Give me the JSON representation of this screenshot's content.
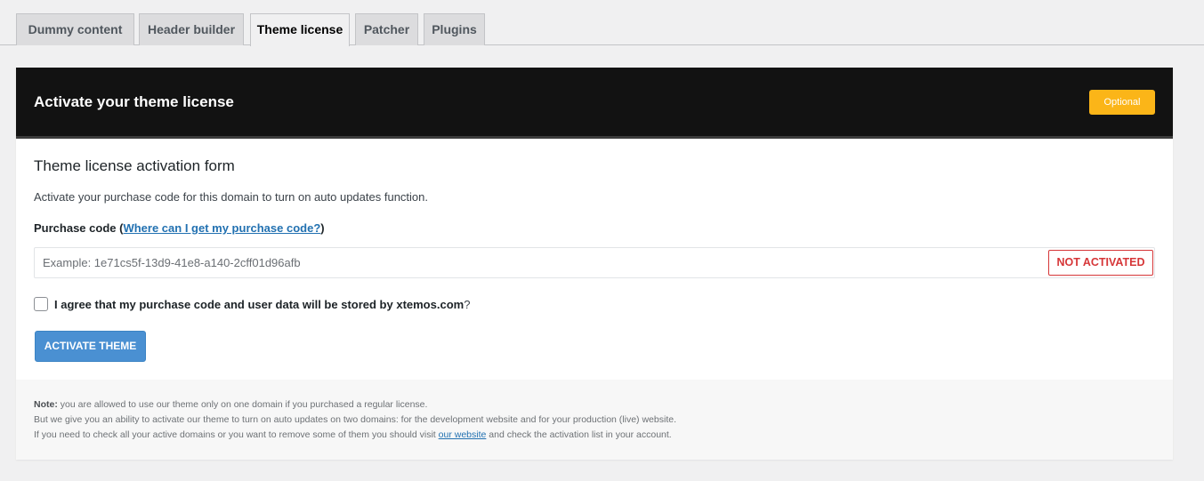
{
  "tabs": [
    {
      "label": "Dummy content",
      "active": false
    },
    {
      "label": "Header builder",
      "active": false
    },
    {
      "label": "Theme license",
      "active": true
    },
    {
      "label": "Patcher",
      "active": false
    },
    {
      "label": "Plugins",
      "active": false
    }
  ],
  "card": {
    "title": "Activate your theme license",
    "badge": "Optional",
    "badge_color": "#fbb518"
  },
  "form": {
    "title": "Theme license activation form",
    "description": "Activate your purchase code for this domain to turn on auto updates function.",
    "field_label": "Purchase code",
    "field_label_open": "(",
    "field_help_link": "Where can I get my purchase code?",
    "field_label_close": ")",
    "input_placeholder": "Example: 1e71cs5f-13d9-41e8-a140-2cff01d96afb",
    "input_value": "",
    "status": "NOT ACTIVATED",
    "status_color": "#d63638",
    "agree_text": "I agree that my purchase code and user data will be stored by xtemos.com",
    "agree_suffix": "?",
    "agree_checked": false,
    "activate_button": "ACTIVATE THEME",
    "button_color": "#4a90d2"
  },
  "note": {
    "label": "Note:",
    "line1": " you are allowed to use our theme only on one domain if you purchased a regular license.",
    "line2": "But we give you an ability to activate our theme to turn on auto updates on two domains: for the development website and for your production (live) website.",
    "line3_before": "If you need to check all your active domains or you want to remove some of them you should visit ",
    "line3_link": "our website",
    "line3_after": " and check the activation list in your account."
  }
}
